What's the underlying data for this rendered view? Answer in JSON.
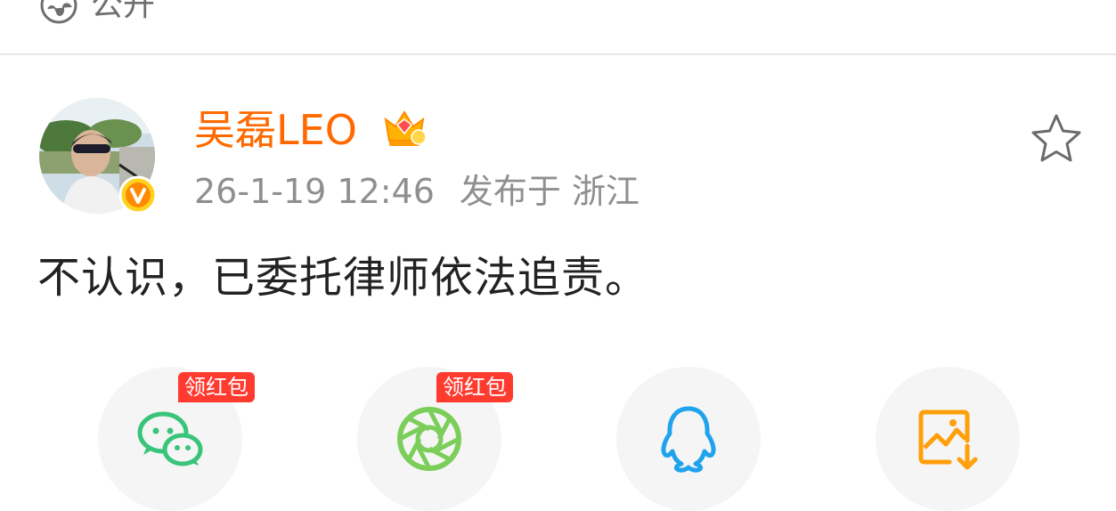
{
  "header": {
    "visibility_label": "公开"
  },
  "post": {
    "author": {
      "name": "吴磊LEO"
    },
    "timestamp": "26-1-19 12:46",
    "location": "发布于 浙江",
    "text": "不认识，已委托律师依法追责。"
  },
  "share": {
    "items": [
      {
        "icon": "wechat-icon",
        "badge": "领红包"
      },
      {
        "icon": "moments-icon",
        "badge": "领红包"
      },
      {
        "icon": "qq-icon"
      },
      {
        "icon": "save-image-icon"
      }
    ]
  },
  "colors": {
    "author_name": "#ff6a00",
    "wechat": "#39c47a",
    "moments": "#7cce5a",
    "qq": "#1fa3ec",
    "save_image": "#ff9f0a",
    "badge": "#ff3b30"
  }
}
